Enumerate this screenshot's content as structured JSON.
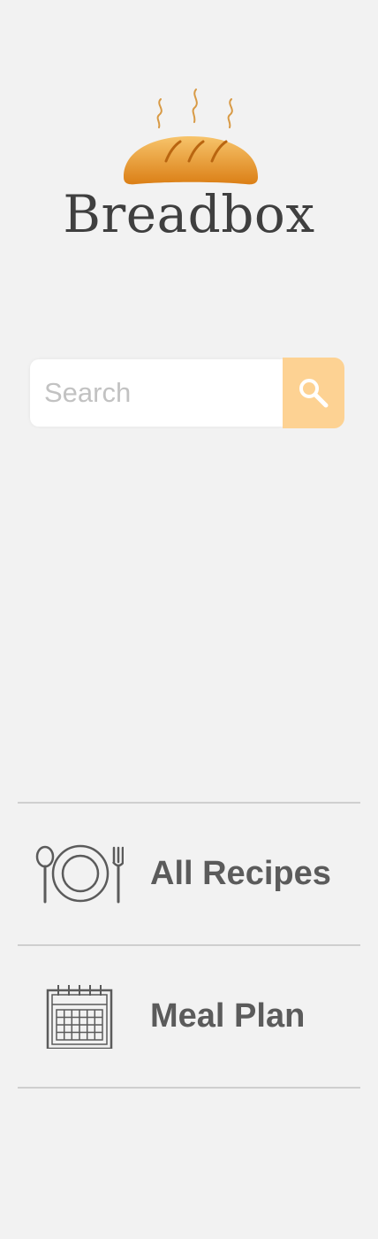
{
  "app": {
    "title": "Breadbox",
    "logo_icon": "bread-loaf-icon"
  },
  "search": {
    "placeholder": "Search",
    "value": "",
    "button_icon": "magnifier-icon"
  },
  "nav": {
    "items": [
      {
        "label": "All Recipes",
        "icon": "plate-utensils-icon"
      },
      {
        "label": "Meal Plan",
        "icon": "calendar-icon"
      }
    ]
  },
  "colors": {
    "background": "#f2f2f2",
    "accent": "#fdd293",
    "bread": "#e8992f",
    "steam": "#d89a45",
    "text": "#5b5b5b",
    "divider": "#cfcfcf"
  }
}
